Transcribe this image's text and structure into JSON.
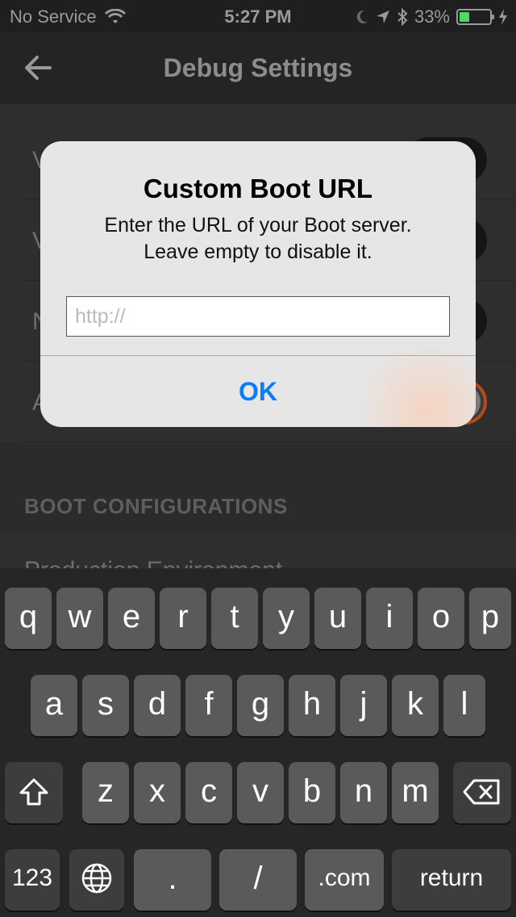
{
  "status_bar": {
    "carrier": "No Service",
    "time": "5:27 PM",
    "battery_percent": "33%",
    "battery_level": 0.33,
    "icons": [
      "wifi-icon",
      "moon-icon",
      "location-icon",
      "bluetooth-icon",
      "battery-icon",
      "charging-icon"
    ]
  },
  "nav": {
    "title": "Debug Settings",
    "back_icon": "back-arrow-icon"
  },
  "settings": {
    "rows": [
      {
        "letter": "V",
        "on": false
      },
      {
        "letter": "V",
        "on": false
      },
      {
        "letter": "N",
        "on": false
      },
      {
        "letter": "A",
        "on": true
      }
    ],
    "section_header": "BOOT CONFIGURATIONS",
    "config_row_label": "Production Environment"
  },
  "alert": {
    "title": "Custom Boot URL",
    "message_line1": "Enter the URL of your Boot server.",
    "message_line2": "Leave empty to disable it.",
    "input_value": "",
    "input_placeholder": "http://",
    "ok_label": "OK"
  },
  "keyboard": {
    "row1": [
      "q",
      "w",
      "e",
      "r",
      "t",
      "y",
      "u",
      "i",
      "o",
      "p"
    ],
    "row2": [
      "a",
      "s",
      "d",
      "f",
      "g",
      "h",
      "j",
      "k",
      "l"
    ],
    "row3": [
      "z",
      "x",
      "c",
      "v",
      "b",
      "n",
      "m"
    ],
    "numbers_label": "123",
    "dot_label": ".",
    "slash_label": "/",
    "dotcom_label": ".com",
    "return_label": "return"
  },
  "colors": {
    "accent": "#0a7cff",
    "toggle_on": "#b34a1a",
    "battery_fill": "#4cd964"
  }
}
